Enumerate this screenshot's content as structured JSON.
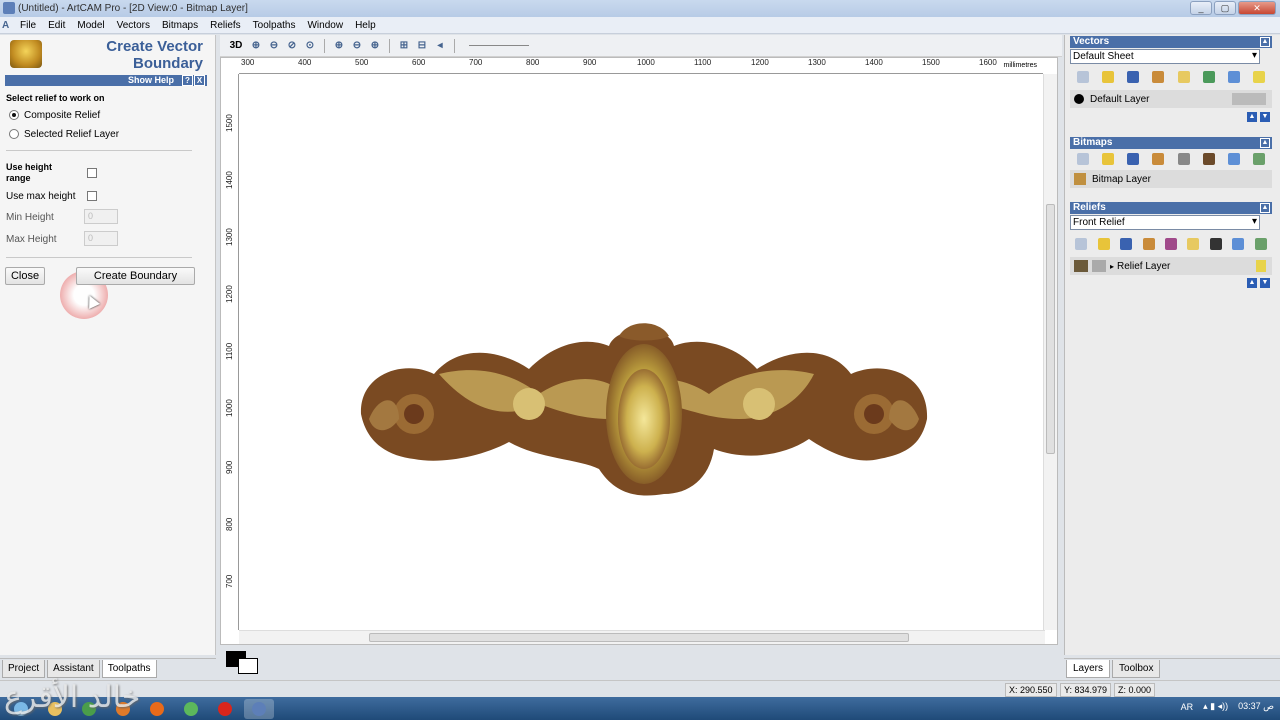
{
  "window": {
    "title": "(Untitled) - ArtCAM Pro - [2D View:0 - Bitmap Layer]",
    "buttons": [
      "_",
      "▢",
      "✕"
    ],
    "mdi_buttons": [
      "-",
      "▫",
      "×"
    ]
  },
  "menu": [
    "File",
    "Edit",
    "Model",
    "Vectors",
    "Bitmaps",
    "Reliefs",
    "Toolpaths",
    "Window",
    "Help"
  ],
  "left_panel": {
    "title_line1": "Create Vector",
    "title_line2": "Boundary",
    "show_help": "Show Help",
    "help_q": "?",
    "help_x": "X",
    "select_relief_label": "Select relief to work on",
    "radio_composite": "Composite Relief",
    "radio_selected": "Selected Relief Layer",
    "use_height_range_1": "Use height",
    "use_height_range_2": "range",
    "use_max_height": "Use max height",
    "min_height": "Min Height",
    "max_height": "Max Height",
    "min_value": "0",
    "max_value": "0",
    "close_button": "Close",
    "create_button": "Create Boundary",
    "tabs": [
      "Project",
      "Assistant",
      "Toolpaths"
    ]
  },
  "view": {
    "toolbar_3d": "3D",
    "units": "millimetres",
    "hruler": [
      "300",
      "400",
      "500",
      "600",
      "700",
      "800",
      "900",
      "1000",
      "1100",
      "1200",
      "1300",
      "1400",
      "1500",
      "1600"
    ],
    "vruler": [
      "1500",
      "1400",
      "1300",
      "1200",
      "1100",
      "1000",
      "900",
      "800",
      "700"
    ]
  },
  "right_panel": {
    "vectors_header": "Vectors",
    "vectors_sheet": "Default Sheet",
    "vectors_layer": "Default Layer",
    "bitmaps_header": "Bitmaps",
    "bitmaps_layer": "Bitmap Layer",
    "reliefs_header": "Reliefs",
    "reliefs_select": "Front Relief",
    "reliefs_layer": "Relief Layer",
    "tabs": [
      "Layers",
      "Toolbox"
    ]
  },
  "status": {
    "x": "X: 290.550",
    "y": "Y: 834.979",
    "z": "Z: 0.000"
  },
  "taskbar": {
    "lang": "AR",
    "time": "03:37 ص"
  },
  "watermark": "خالد الأقرع",
  "colors": {
    "accent": "#4a6fa8",
    "title": "#3b5f98",
    "ornament_dark": "#6b3a1c",
    "ornament_light": "#e6d77a"
  }
}
